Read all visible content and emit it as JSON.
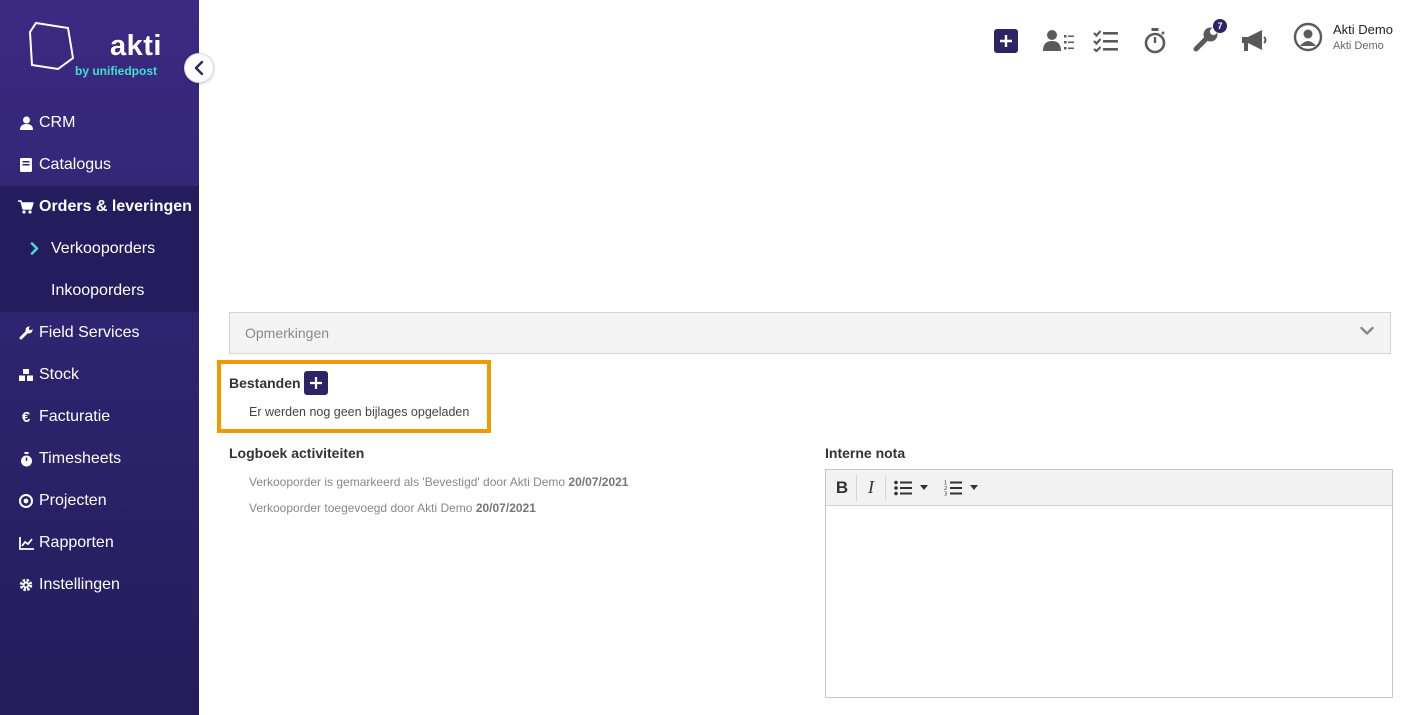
{
  "brand": {
    "name": "akti",
    "tagline": "by unifiedpost"
  },
  "sidebar": {
    "items": [
      {
        "label": "CRM",
        "icon": "user-icon"
      },
      {
        "label": "Catalogus",
        "icon": "book-icon"
      },
      {
        "label": "Orders & leveringen",
        "icon": "cart-icon",
        "active": true,
        "children": [
          {
            "label": "Verkooporders",
            "active": true
          },
          {
            "label": "Inkooporders"
          }
        ]
      },
      {
        "label": "Field Services",
        "icon": "wrench-icon"
      },
      {
        "label": "Stock",
        "icon": "cubes-icon"
      },
      {
        "label": "Facturatie",
        "icon": "euro-icon"
      },
      {
        "label": "Timesheets",
        "icon": "stopwatch-icon"
      },
      {
        "label": "Projecten",
        "icon": "target-icon"
      },
      {
        "label": "Rapporten",
        "icon": "chart-icon"
      },
      {
        "label": "Instellingen",
        "icon": "gear-icon"
      }
    ]
  },
  "topbar": {
    "notifications_badge": "7",
    "user": {
      "name": "Akti Demo",
      "company": "Akti Demo"
    }
  },
  "content": {
    "opmerkingen_label": "Opmerkingen",
    "bestanden": {
      "title": "Bestanden",
      "empty_text": "Er werden nog geen bijlages opgeladen"
    },
    "logboek": {
      "title": "Logboek activiteiten",
      "entries": [
        {
          "text": "Verkooporder is gemarkeerd als 'Bevestigd' door Akti Demo",
          "date": "20/07/2021"
        },
        {
          "text": "Verkooporder toegevoegd door Akti Demo",
          "date": "20/07/2021"
        }
      ]
    },
    "interne_nota": {
      "title": "Interne nota",
      "toolbar": {
        "bold": "B",
        "italic": "I"
      }
    }
  },
  "colors": {
    "accent": "#2d2466",
    "highlight": "#f09a00",
    "teal": "#3fe0d0"
  }
}
